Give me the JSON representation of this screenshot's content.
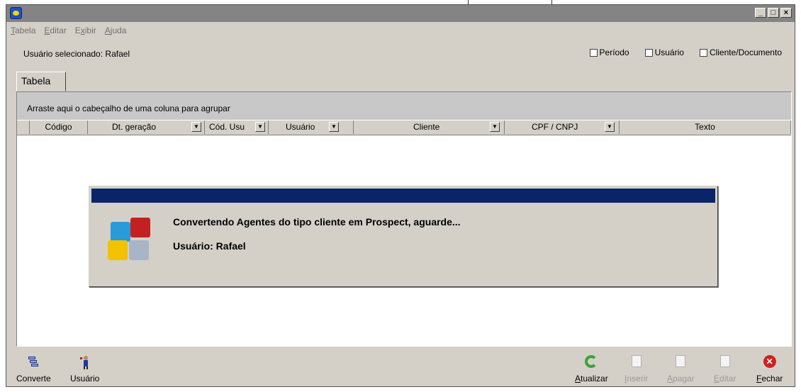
{
  "window": {
    "controls": {
      "minimize": "_",
      "maximize": "□",
      "close": "×"
    }
  },
  "menu": {
    "items": [
      {
        "label": "Tabela",
        "accel": "T",
        "rest": "abela"
      },
      {
        "label": "Editar",
        "accel": "E",
        "rest": "ditar"
      },
      {
        "label": "Exibir",
        "pre": "E",
        "accel": "x",
        "rest": "ibir"
      },
      {
        "label": "Ajuda",
        "accel": "A",
        "rest": "juda"
      }
    ]
  },
  "header": {
    "selected_user": "Usuário selecionado: Rafael",
    "filters": [
      {
        "label": "Período",
        "checked": false
      },
      {
        "label": "Usuário",
        "checked": false
      },
      {
        "label": "Cliente/Documento",
        "checked": false
      }
    ]
  },
  "tabs": [
    {
      "label": "Tabela"
    }
  ],
  "grid": {
    "group_hint": "Arraste aqui o cabeçalho de uma coluna para agrupar",
    "columns": [
      {
        "label": "Código",
        "dropdown": false
      },
      {
        "label": "Dt. geração",
        "dropdown": true
      },
      {
        "label": "Cód. Usu",
        "dropdown": true
      },
      {
        "label": "Usuário",
        "dropdown": true
      },
      {
        "label": "Cliente",
        "dropdown": true
      },
      {
        "label": "CPF / CNPJ",
        "dropdown": true
      },
      {
        "label": "Texto",
        "dropdown": false
      }
    ]
  },
  "dialog": {
    "message": "Convertendo Agentes do tipo cliente em Prospect, aguarde...",
    "user_line": "Usuário: Rafael",
    "title_bar_color": "#0a246a"
  },
  "toolbar": {
    "left": [
      {
        "label": "Converte",
        "icon": "convert-icon"
      },
      {
        "label": "Usuário",
        "icon": "user-icon"
      }
    ],
    "right": [
      {
        "label": "Atualizar",
        "accel": "A",
        "rest": "tualizar",
        "icon": "refresh-icon",
        "enabled": true
      },
      {
        "label": "Inserir",
        "accel": "I",
        "rest": "nserir",
        "icon": "insert-icon",
        "enabled": false
      },
      {
        "label": "Apagar",
        "accel": "A",
        "rest": "pagar",
        "icon": "delete-icon",
        "enabled": false
      },
      {
        "label": "Editar",
        "accel": "E",
        "rest": "ditar",
        "icon": "edit-icon",
        "enabled": false
      },
      {
        "label": "Fechar",
        "accel": "F",
        "rest": "echar",
        "icon": "close-circle-icon",
        "enabled": true
      }
    ]
  }
}
